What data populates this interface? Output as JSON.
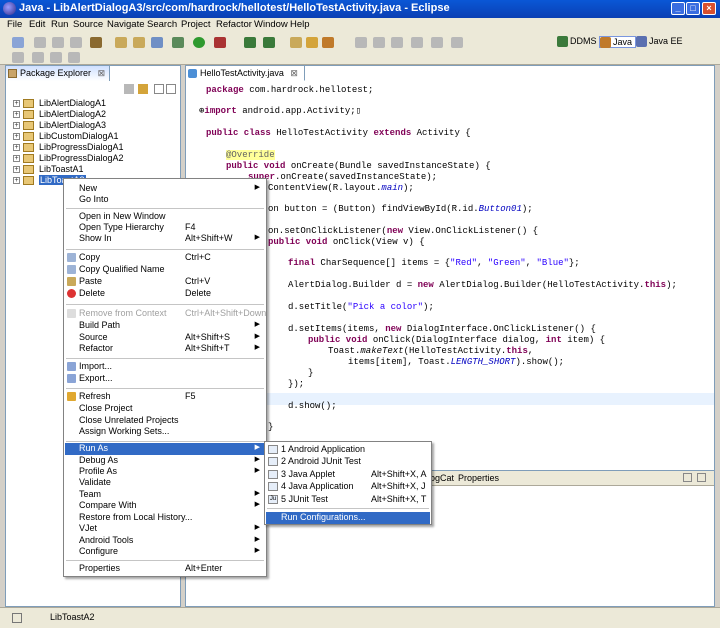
{
  "window": {
    "title": "Java - LibAlertDialogA3/src/com/hardrock/hellotest/HelloTestActivity.java - Eclipse",
    "controls": [
      "_",
      "□",
      "×"
    ]
  },
  "menubar": [
    "File",
    "Edit",
    "Run",
    "Source",
    "Navigate",
    "Search",
    "Project",
    "Refactor",
    "Window",
    "Help"
  ],
  "perspectives": [
    {
      "label": "DDMS",
      "icon": "ddms-icon",
      "color": "#3b7a3b"
    },
    {
      "label": "Java",
      "icon": "java-perspective-icon",
      "color": "#c07a2a"
    },
    {
      "label": "Java EE",
      "icon": "javaee-perspective-icon",
      "color": "#5a6fb0"
    }
  ],
  "package_explorer": {
    "tab_label": "Package Explorer",
    "close": "⊠",
    "projects": [
      "LibAlertDialogA1",
      "LibAlertDialogA2",
      "LibAlertDialogA3",
      "LibCustomDialogA1",
      "LibProgressDialogA1",
      "LibProgressDialogA2",
      "LibToastA1",
      "LibToastA2"
    ],
    "selected_index": 7
  },
  "editor": {
    "tab_label": "HelloTestActivity.java",
    "close": "⊠"
  },
  "code": [
    "package com.hardrock.hellotest;",
    "import android.app.Activity;",
    "public class HelloTestActivity extends Activity {",
    "@Override",
    "public void onCreate(Bundle savedInstanceState) {",
    "super.onCreate(savedInstanceState);",
    "ContentView(R.layout.main);",
    "on button = (Button) findViewById(R.id.Button01);",
    "on.setOnClickListener(new View.OnClickListener() {",
    "public void onClick(View v) {",
    "final CharSequence[] items = {\"Red\", \"Green\", \"Blue\"};",
    "AlertDialog.Builder d = new AlertDialog.Builder(HelloTestActivity.this);",
    "d.setTitle(\"Pick a color\");",
    "d.setItems(items, new DialogInterface.OnClickListener() {",
    "public void onClick(DialogInterface dialog, int item) {",
    "Toast.makeText(HelloTestActivity.this,",
    "items[item], Toast.LENGTH_SHORT).show();",
    "}",
    "});",
    "d.show();",
    "}"
  ],
  "bottom_panel": {
    "tabs": [
      "ogCat",
      "Properties"
    ]
  },
  "context_menu": {
    "items": [
      {
        "label": "New",
        "accel": "",
        "submenu": true
      },
      {
        "label": "Go Into",
        "accel": ""
      },
      {
        "sep": true
      },
      {
        "label": "Open in New Window",
        "accel": ""
      },
      {
        "label": "Open Type Hierarchy",
        "accel": "F4"
      },
      {
        "label": "Show In",
        "accel": "Alt+Shift+W",
        "submenu": true
      },
      {
        "sep": true
      },
      {
        "label": "Copy",
        "accel": "Ctrl+C",
        "icon": "copy-icon"
      },
      {
        "label": "Copy Qualified Name",
        "accel": "",
        "icon": "copy-qualified-name-icon"
      },
      {
        "label": "Paste",
        "accel": "Ctrl+V",
        "icon": "paste-icon"
      },
      {
        "label": "Delete",
        "accel": "Delete",
        "icon": "delete-icon"
      },
      {
        "sep": true
      },
      {
        "label": "Remove from Context",
        "accel": "Ctrl+Alt+Shift+Down",
        "disabled": true,
        "icon": "remove-from-context-icon"
      },
      {
        "label": "Build Path",
        "accel": "",
        "submenu": true
      },
      {
        "label": "Source",
        "accel": "Alt+Shift+S",
        "submenu": true
      },
      {
        "label": "Refactor",
        "accel": "Alt+Shift+T",
        "submenu": true
      },
      {
        "sep": true
      },
      {
        "label": "Import...",
        "accel": "",
        "icon": "import-icon"
      },
      {
        "label": "Export...",
        "accel": "",
        "icon": "export-icon"
      },
      {
        "sep": true
      },
      {
        "label": "Refresh",
        "accel": "F5",
        "icon": "refresh-icon"
      },
      {
        "label": "Close Project",
        "accel": ""
      },
      {
        "label": "Close Unrelated Projects",
        "accel": ""
      },
      {
        "label": "Assign Working Sets...",
        "accel": ""
      },
      {
        "sep": true
      },
      {
        "label": "Run As",
        "accel": "",
        "submenu": true,
        "highlighted": true
      },
      {
        "label": "Debug As",
        "accel": "",
        "submenu": true
      },
      {
        "label": "Profile As",
        "accel": "",
        "submenu": true
      },
      {
        "label": "Validate",
        "accel": ""
      },
      {
        "label": "Team",
        "accel": "",
        "submenu": true
      },
      {
        "label": "Compare With",
        "accel": "",
        "submenu": true
      },
      {
        "label": "Restore from Local History...",
        "accel": ""
      },
      {
        "label": "VJet",
        "accel": "",
        "submenu": true
      },
      {
        "label": "Android Tools",
        "accel": "",
        "submenu": true
      },
      {
        "label": "Configure",
        "accel": "",
        "submenu": true
      },
      {
        "sep": true
      },
      {
        "label": "Properties",
        "accel": "Alt+Enter"
      }
    ]
  },
  "run_as_submenu": {
    "items": [
      {
        "label": "1 Android Application",
        "accel": "",
        "icon": "android-app-icon"
      },
      {
        "label": "2 Android JUnit Test",
        "accel": "",
        "icon": "android-junit-icon"
      },
      {
        "label": "3 Java Applet",
        "accel": "Alt+Shift+X, A",
        "icon": "java-applet-icon"
      },
      {
        "label": "4 Java Application",
        "accel": "Alt+Shift+X, J",
        "icon": "java-application-icon"
      },
      {
        "label": "5 JUnit Test",
        "accel": "Alt+Shift+X, T",
        "icon": "junit-icon",
        "glyph": "Ju"
      },
      {
        "sep": true
      },
      {
        "label": "Run Configurations...",
        "accel": "",
        "highlighted": true
      }
    ]
  },
  "status": {
    "text": "LibToastA2"
  }
}
